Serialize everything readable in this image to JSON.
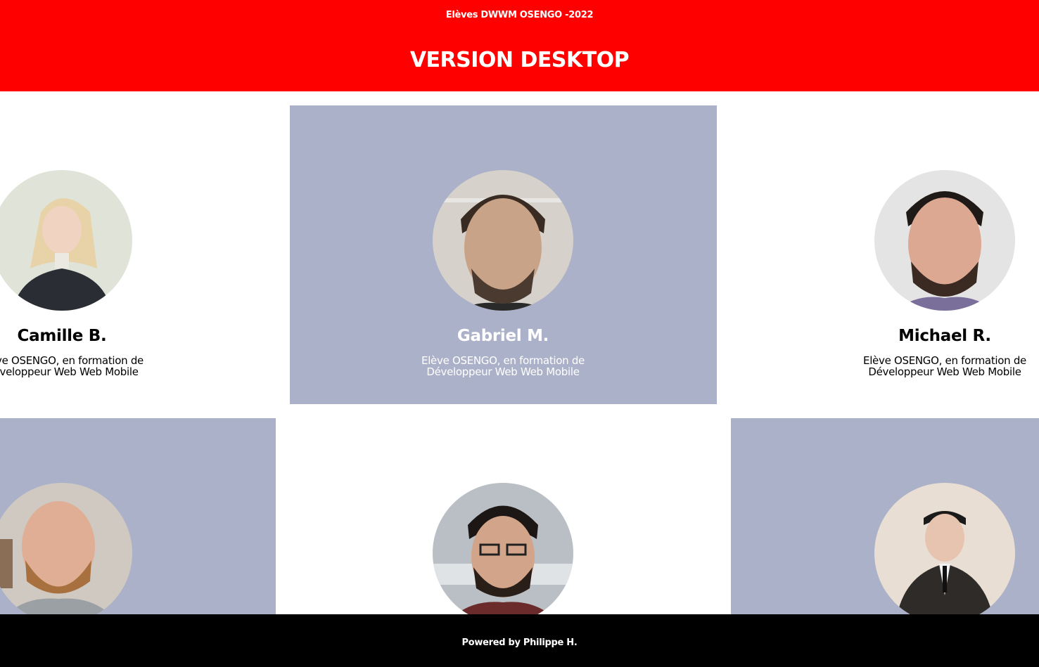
{
  "header": {
    "subtitle": "Elèves DWWM OSENGO -2022",
    "title": "VERSION DESKTOP"
  },
  "students": [
    {
      "name": "Camille B.",
      "description": "Elève OSENGO, en formation de Développeur Web Web Mobile",
      "photo": "student-photo"
    },
    {
      "name": "Gabriel M.",
      "description": "Elève OSENGO, en formation de Développeur Web Web Mobile",
      "photo": "student-photo"
    },
    {
      "name": "Michael R.",
      "description": "Elève OSENGO, en formation de Développeur Web Web Mobile",
      "photo": "student-photo"
    },
    {
      "photo": "student-photo"
    },
    {
      "photo": "student-photo"
    },
    {
      "photo": "student-photo"
    }
  ],
  "footer": {
    "credit": "Powered by Philippe H."
  },
  "colors": {
    "header_bg": "#ff0000",
    "card_shaded_bg": "#abb1c8",
    "footer_bg": "#000000",
    "text_light": "#ffffff",
    "text_dark": "#000000"
  }
}
